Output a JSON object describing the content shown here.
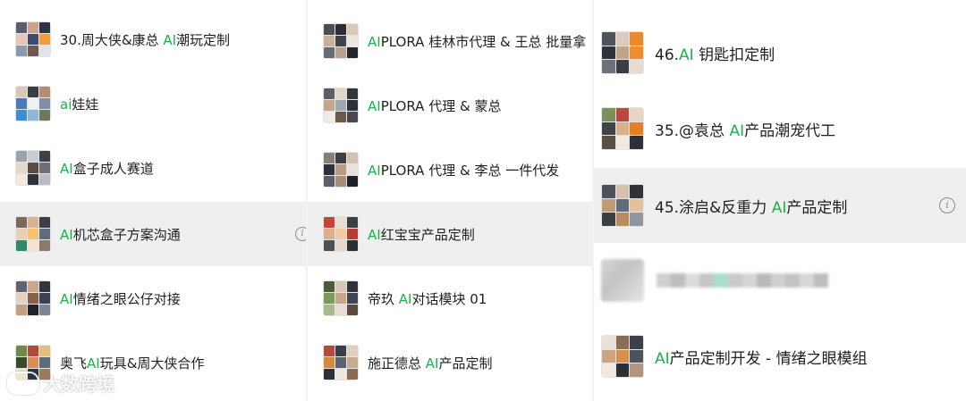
{
  "accent_color": "#18b34a",
  "column1": {
    "chats": [
      {
        "pre": "30.周大侠&康总 ",
        "hl": "AI",
        "post": "潮玩定制"
      },
      {
        "pre": "",
        "hl": "ai",
        "post": "娃娃"
      },
      {
        "pre": "",
        "hl": "AI",
        "post": "盒子成人赛道"
      },
      {
        "pre": "",
        "hl": "AI",
        "post": "机芯盒子方案沟通",
        "info_icon": "info-icon"
      },
      {
        "pre": "",
        "hl": "AI",
        "post": "情绪之眼公仔对接"
      },
      {
        "pre": "奥飞",
        "hl": "AI",
        "post": "玩具&周大侠合作"
      }
    ]
  },
  "column2": {
    "chats": [
      {
        "pre": "",
        "hl": "AI",
        "post": "PLORA 桂林市代理 & 王总 批量拿"
      },
      {
        "pre": "",
        "hl": "AI",
        "post": "PLORA 代理 & 蒙总"
      },
      {
        "pre": "",
        "hl": "AI",
        "post": "PLORA 代理 & 李总 一件代发"
      },
      {
        "pre": "",
        "hl": "AI",
        "post": "红宝宝产品定制"
      },
      {
        "pre": "帝玖 ",
        "hl": "AI",
        "post": "对话模块 01"
      },
      {
        "pre": "施正德总 ",
        "hl": "AI",
        "post": "产品定制"
      }
    ]
  },
  "column3": {
    "chats": [
      {
        "pre": "46.",
        "hl": "AI",
        "post": " 钥匙扣定制"
      },
      {
        "pre": "35.@袁总 ",
        "hl": "AI",
        "post": "产品潮宠代工"
      },
      {
        "pre": "45.涂启&反重力 ",
        "hl": "AI",
        "post": "产品定制",
        "info_icon": "info-icon"
      },
      {
        "blurred": true
      },
      {
        "pre": "",
        "hl": "AI",
        "post": "产品定制开发 - 情绪之眼模组"
      }
    ]
  },
  "watermark": {
    "text": "大数跨境",
    "icon": "cloud-logo-icon"
  }
}
